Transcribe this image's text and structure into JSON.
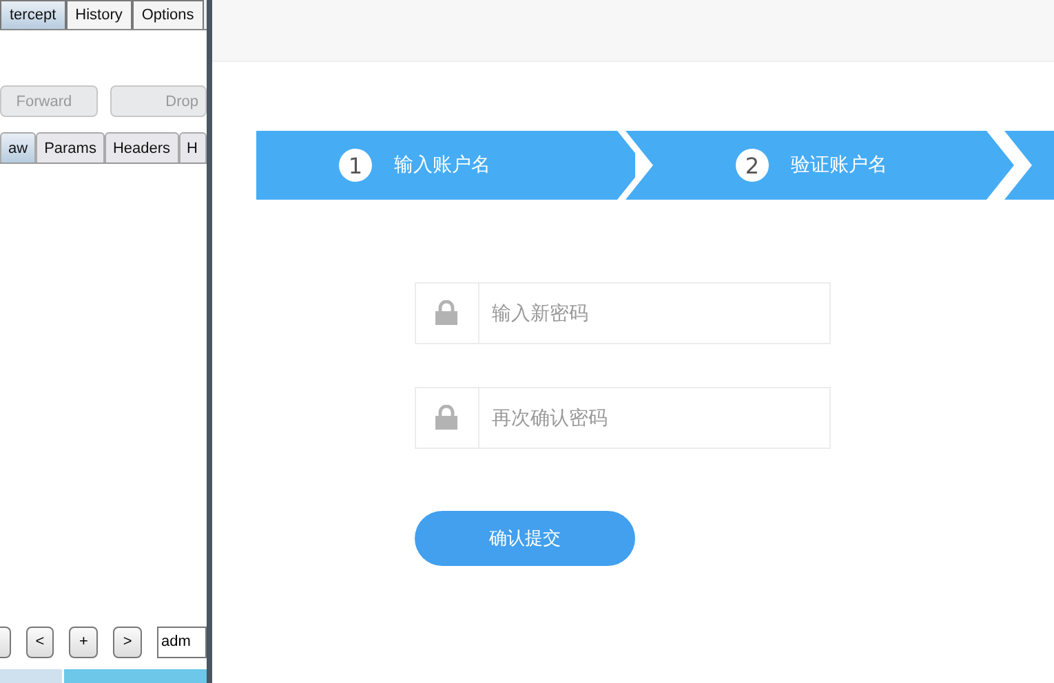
{
  "proxy_panel": {
    "tabs": [
      {
        "label": "tercept",
        "selected": true
      },
      {
        "label": "History",
        "selected": false
      },
      {
        "label": "Options",
        "selected": false
      }
    ],
    "actions": [
      {
        "label": "Forward",
        "disabled": true
      },
      {
        "label": "Drop",
        "disabled": true
      }
    ],
    "message_tabs": [
      {
        "label": "aw",
        "selected": true
      },
      {
        "label": "Params",
        "selected": false
      },
      {
        "label": "Headers",
        "selected": false
      },
      {
        "label": "H",
        "selected": false
      }
    ],
    "search_buttons": [
      "<",
      "+",
      ">"
    ],
    "search_value": "adm"
  },
  "steps": [
    {
      "kind": "numbered",
      "number": "1",
      "label": "输入账户名"
    },
    {
      "kind": "numbered",
      "number": "2",
      "label": "验证账户名"
    },
    {
      "kind": "cut"
    }
  ],
  "fields": [
    {
      "placeholder": "输入新密码"
    },
    {
      "placeholder": "再次确认密码"
    }
  ],
  "submit": "确认提交"
}
